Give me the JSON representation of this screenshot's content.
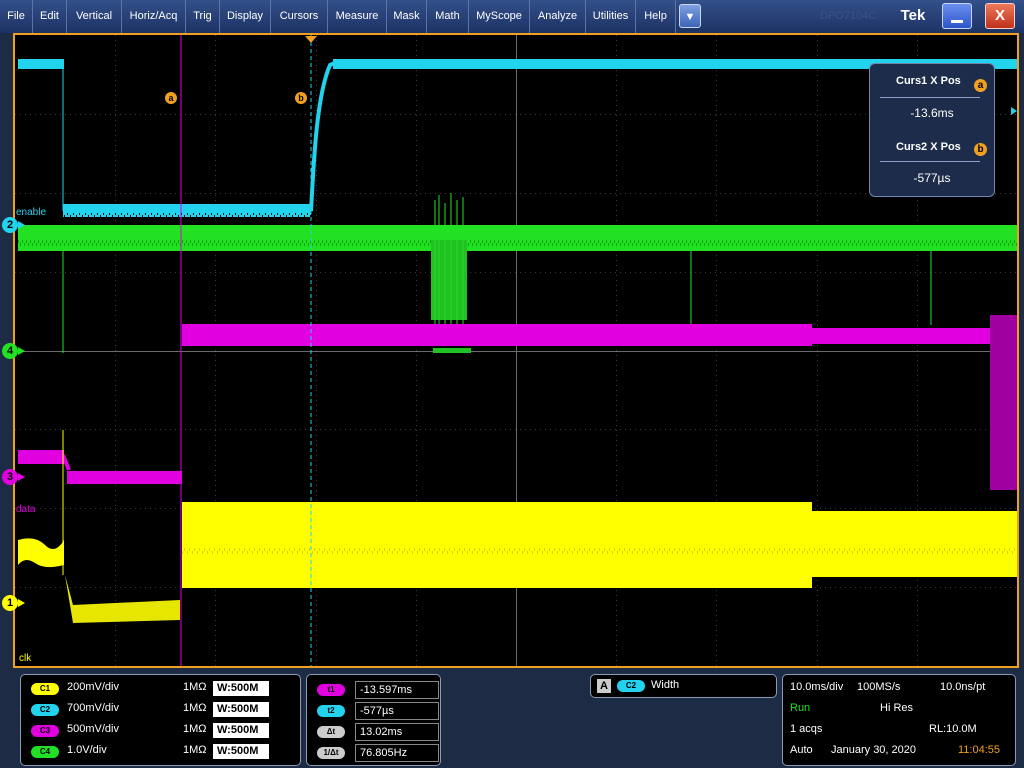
{
  "menu": {
    "items": [
      "File",
      "Edit",
      "Vertical",
      "Horiz/Acq",
      "Trig",
      "Display",
      "Cursors",
      "Measure",
      "Mask",
      "Math",
      "MyScope",
      "Analyze",
      "Utilities",
      "Help"
    ],
    "dropdown_glyph": "▼",
    "ghost_text": "DPO7104C",
    "logo": "Tek",
    "close_glyph": "X"
  },
  "display": {
    "channel_markers": [
      "2",
      "4",
      "3",
      "1"
    ],
    "channel_labels": [
      "enable",
      "data",
      "clk"
    ],
    "cursor_badges": [
      "a",
      "b"
    ],
    "colors": {
      "ch1": "#ffff00",
      "ch2": "#22d3ee",
      "ch3": "#e000e0",
      "ch4": "#22e022",
      "cursor": "#f0a020"
    }
  },
  "cursor_readout": {
    "curs1_label": "Curs1 X Pos",
    "curs1_badge": "a",
    "curs1_value": "-13.6ms",
    "curs2_label": "Curs2 X Pos",
    "curs2_badge": "b",
    "curs2_value": "-577µs"
  },
  "channels": [
    {
      "badge": "C1",
      "scale": "200mV/div",
      "impedance": "1MΩ",
      "bandwidth": "W:500M"
    },
    {
      "badge": "C2",
      "scale": "700mV/div",
      "impedance": "1MΩ",
      "bandwidth": "W:500M"
    },
    {
      "badge": "C3",
      "scale": "500mV/div",
      "impedance": "1MΩ",
      "bandwidth": "W:500M"
    },
    {
      "badge": "C4",
      "scale": "1.0V/div",
      "impedance": "1MΩ",
      "bandwidth": "W:500M"
    }
  ],
  "cursor_values": [
    {
      "label": "t1",
      "value": "-13.597ms"
    },
    {
      "label": "t2",
      "value": "-577µs"
    },
    {
      "label": "Δt",
      "value": "13.02ms"
    },
    {
      "label": "1/Δt",
      "value": "76.805Hz"
    }
  ],
  "measurement": {
    "letter": "A",
    "source": "C2",
    "name": "Width"
  },
  "acquisition": {
    "timebase": "10.0ms/div",
    "sample_rate": "100MS/s",
    "resolution": "10.0ns/pt",
    "state": "Run",
    "mode": "Hi Res",
    "acqs": "1 acqs",
    "record_length": "RL:10.0M",
    "trigger_mode": "Auto",
    "date": "January 30, 2020",
    "time": "11:04:55"
  }
}
